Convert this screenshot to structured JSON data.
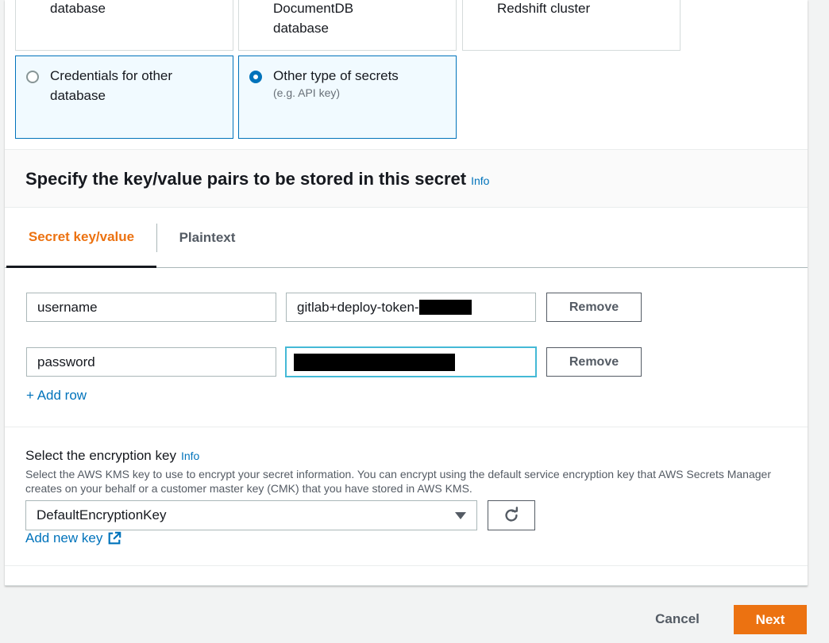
{
  "secret_types": {
    "tile_a_line1": "database",
    "tile_b_line1": "DocumentDB",
    "tile_b_line2": "database",
    "tile_c_line1": "Redshift cluster",
    "tile_d_label": "Credentials for other database",
    "tile_e_label": "Other type of secrets",
    "tile_e_sub": "(e.g. API key)"
  },
  "kv_section": {
    "title": "Specify the key/value pairs to be stored in this secret",
    "info": "Info"
  },
  "tabs": [
    {
      "label": "Secret key/value",
      "active": true
    },
    {
      "label": "Plaintext",
      "active": false
    }
  ],
  "rows": [
    {
      "key": "username",
      "value": "gitlab+deploy-token-",
      "remove": "Remove"
    },
    {
      "key": "password",
      "value": "",
      "remove": "Remove"
    }
  ],
  "add_row": "+ Add row",
  "encryption": {
    "label": "Select the encryption key",
    "info": "Info",
    "description": "Select the AWS KMS key to use to encrypt your secret information. You can encrypt using the default service encryption key that AWS Secrets Manager creates on your behalf or a customer master key (CMK) that you have stored in AWS KMS.",
    "selected": "DefaultEncryptionKey",
    "add_key": "Add new key"
  },
  "footer": {
    "cancel": "Cancel",
    "next": "Next"
  },
  "colors": {
    "accent": "#ec7211",
    "link": "#0073bb",
    "selected_tile_bg": "#f1faff"
  }
}
